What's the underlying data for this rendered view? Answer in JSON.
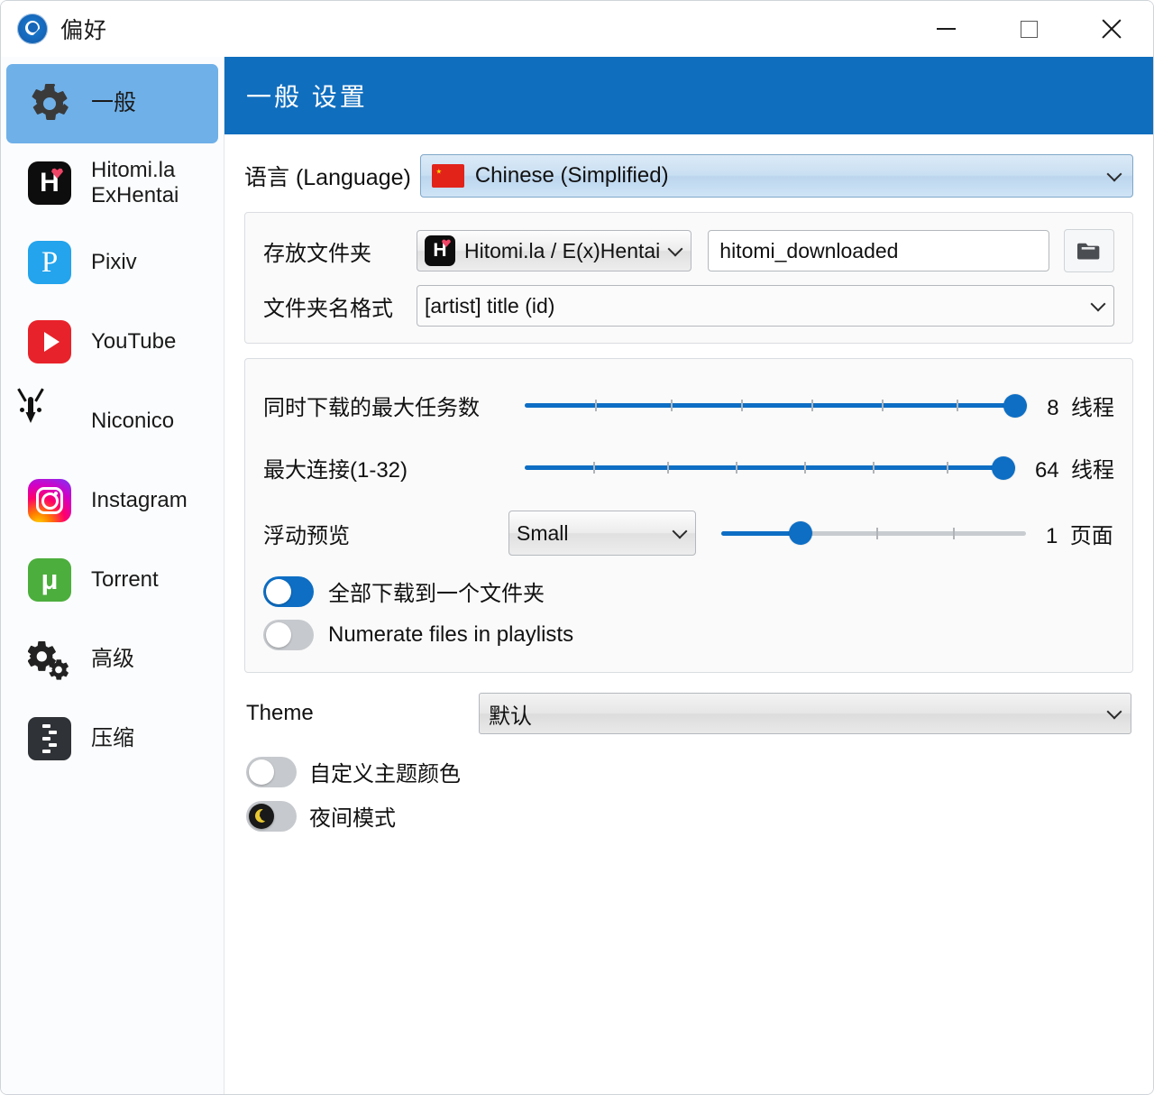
{
  "window": {
    "title": "偏好",
    "app_icon": "app-logo-icon",
    "controls": {
      "minimize": "minimize-button",
      "maximize": "maximize-button",
      "close": "close-button"
    }
  },
  "sidebar": {
    "items": [
      {
        "label": "一般",
        "icon": "gear-icon",
        "active": true
      },
      {
        "label": "Hitomi.la\nExHentai",
        "icon": "hitomi-icon",
        "active": false
      },
      {
        "label": "Pixiv",
        "icon": "pixiv-icon",
        "active": false
      },
      {
        "label": "YouTube",
        "icon": "youtube-icon",
        "active": false
      },
      {
        "label": "Niconico",
        "icon": "niconico-icon",
        "active": false
      },
      {
        "label": "Instagram",
        "icon": "instagram-icon",
        "active": false
      },
      {
        "label": "Torrent",
        "icon": "torrent-icon",
        "active": false
      },
      {
        "label": "高级",
        "icon": "gears-icon",
        "active": false
      },
      {
        "label": "压缩",
        "icon": "zip-icon",
        "active": false
      }
    ]
  },
  "main": {
    "header": "一般 设置",
    "language": {
      "label": "语言 (Language)",
      "value": "Chinese (Simplified)",
      "flag": "flag-cn-icon"
    },
    "folder_group": {
      "save_folder_label": "存放文件夹",
      "site_select_value": "Hitomi.la / E(x)Hentai",
      "site_select_icon": "hitomi-icon",
      "folder_path_value": "hitomi_downloaded",
      "browse_icon": "folder-open-icon",
      "name_format_label": "文件夹名格式",
      "name_format_value": "[artist] title (id)"
    },
    "download_group": {
      "sliders": [
        {
          "label": "同时下载的最大任务数",
          "value": "8",
          "unit": "线程",
          "percent": 100,
          "ticks": [
            0,
            14,
            29,
            43,
            57,
            71,
            86,
            100
          ]
        },
        {
          "label": "最大连接(1-32)",
          "value": "64",
          "unit": "线程",
          "percent": 100,
          "ticks": [
            0,
            14,
            29,
            43,
            57,
            71,
            86,
            100
          ]
        }
      ],
      "preview": {
        "label": "浮动预览",
        "size_value": "Small",
        "page_value": "1",
        "page_unit": "页面",
        "percent": 26,
        "ticks": [
          51,
          76
        ]
      },
      "toggles": [
        {
          "label": "全部下载到一个文件夹",
          "on": true,
          "style": "blue"
        },
        {
          "label": "Numerate files in playlists",
          "on": false,
          "style": "grey"
        }
      ]
    },
    "theme": {
      "label": "Theme",
      "value": "默认",
      "toggles": [
        {
          "label": "自定义主题颜色",
          "on": false,
          "style": "grey"
        },
        {
          "label": "夜间模式",
          "on": false,
          "style": "dark",
          "icon": "moon-icon"
        }
      ]
    }
  }
}
